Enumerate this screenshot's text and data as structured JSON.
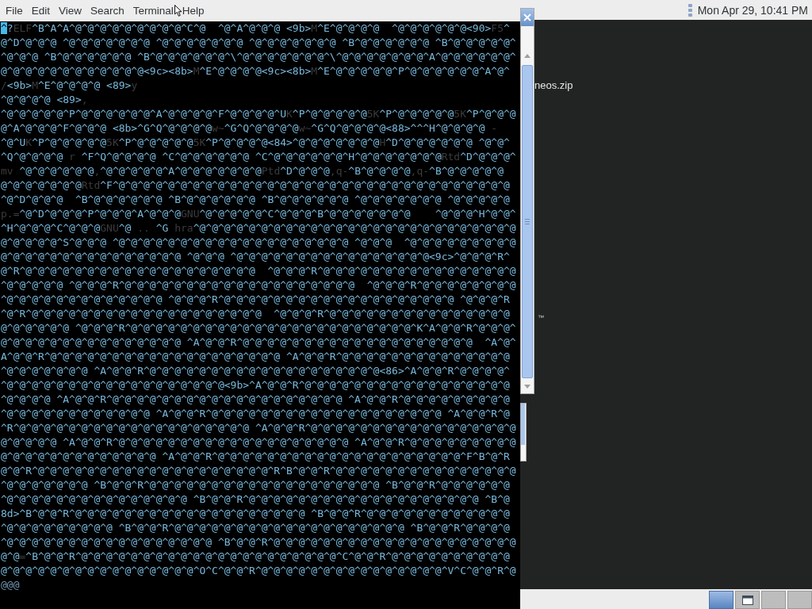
{
  "terminal": {
    "menu": [
      "File",
      "Edit",
      "View",
      "Search",
      "Terminal",
      "Help"
    ],
    "lines": [
      [
        {
          "kind": "cursor",
          "text": "^"
        },
        {
          "kind": "escape",
          "text": "?"
        },
        {
          "kind": "dim",
          "text": "ELF"
        },
        {
          "kind": "escape",
          "text": "^B^A^A^@^@^@^@^@^@^@^@^@^C^@  ^@^A^@^@^@ <9b>"
        },
        {
          "kind": "dim",
          "text": "M"
        },
        {
          "kind": "escape",
          "text": "^E^@^@^@^@  ^@^@^@^@^@^@<90>"
        },
        {
          "kind": "dim",
          "text": "F5"
        },
        {
          "kind": "escape",
          "text": "^"
        }
      ],
      [
        {
          "kind": "escape",
          "text": "@^D^@^@^@ ^@^@^@^@^@^@^@ ^@^@^@^@^@^@^@ ^@^@^@^@^@^@^@ ^B^@^@^@^@^@^@ ^B^@^@^@^@^@^"
        }
      ],
      [
        {
          "kind": "escape",
          "text": "^@^@^@ ^B^@^@^@^@^@^@ ^B^@^@^@^@^@^@^\\^@^@^@^@^@^@^@^\\^@^@^@^@^@^@^@^A^@^@^@^@^@^@^"
        }
      ],
      [
        {
          "kind": "escape",
          "text": "@^@^@^@^@^@^@^@^@^@^@^@<9c><8b>"
        },
        {
          "kind": "dim",
          "text": "M"
        },
        {
          "kind": "escape",
          "text": "^E^@^@^@^@<9c><8b>"
        },
        {
          "kind": "dim",
          "text": "M"
        },
        {
          "kind": "escape",
          "text": "^E^@^@^@^@^@^P^@^@^@^@^@^@^A^@^"
        }
      ],
      [
        {
          "kind": "dim",
          "text": "/"
        },
        {
          "kind": "escape",
          "text": "<9b>"
        },
        {
          "kind": "dim",
          "text": "M"
        },
        {
          "kind": "escape",
          "text": "^E^@^@^@^@ <89>"
        },
        {
          "kind": "dim",
          "text": "y"
        }
      ],
      [
        {
          "kind": "escape",
          "text": "^@^@^@^@ <89>"
        },
        {
          "kind": "dim",
          "text": ","
        }
      ],
      [
        {
          "kind": "escape",
          "text": "^@^@^@^@^@^P^@^@^@^@^@^@^A^@^@^@^@^F^@^@^@^@^U"
        },
        {
          "kind": "dim",
          "text": "K"
        },
        {
          "kind": "escape",
          "text": "^P^@^@^@^@^@"
        },
        {
          "kind": "dim",
          "text": "5K"
        },
        {
          "kind": "escape",
          "text": "^P^@^@^@^@^@"
        },
        {
          "kind": "dim",
          "text": "5K"
        },
        {
          "kind": "escape",
          "text": "^P^@^@^@"
        }
      ],
      [
        {
          "kind": "escape",
          "text": "@^A^@^@^@^F^@^@^@ <8b>^G^Q^@^@^@^@"
        },
        {
          "kind": "dim",
          "text": "w~"
        },
        {
          "kind": "escape",
          "text": "^G^Q^@^@^@^@"
        },
        {
          "kind": "dim",
          "text": "w~"
        },
        {
          "kind": "escape",
          "text": "^G^Q^@^@^@^@<88>^^^H^@^@^@^@"
        },
        {
          "kind": "dim",
          "text": " -"
        }
      ],
      [
        {
          "kind": "escape",
          "text": "^@^U"
        },
        {
          "kind": "dim",
          "text": "K"
        },
        {
          "kind": "escape",
          "text": "^P^@^@^@^@^@"
        },
        {
          "kind": "dim",
          "text": "5K"
        },
        {
          "kind": "escape",
          "text": "^P^@^@^@^@^@"
        },
        {
          "kind": "dim",
          "text": "5K"
        },
        {
          "kind": "escape",
          "text": "^P^@^@^@^@<84>^@^@^@^@^@^@^@"
        },
        {
          "kind": "dim",
          "text": "H"
        },
        {
          "kind": "escape",
          "text": "^D^@^@^@^@^@^@ ^@^@^"
        }
      ],
      [
        {
          "kind": "escape",
          "text": "^Q^@^@^@^@"
        },
        {
          "kind": "dim",
          "text": " r "
        },
        {
          "kind": "escape",
          "text": "^F^Q^@^@^@^@ ^C^@^@^@^@^@^@ ^C^@^@^@^@^@^@^H^@^@^@^@^@^@^@"
        },
        {
          "kind": "dim",
          "text": "Rtd"
        },
        {
          "kind": "escape",
          "text": "^D^@^@^@^"
        }
      ],
      [
        {
          "kind": "dim",
          "text": "mv "
        },
        {
          "kind": "escape",
          "text": "^@^@^@^@^@^@"
        },
        {
          "kind": "dim",
          "text": ","
        },
        {
          "kind": "escape",
          "text": "^@^@^@^@^@^A^@^@^@^@^@^@^@"
        },
        {
          "kind": "dim",
          "text": "Ptd"
        },
        {
          "kind": "escape",
          "text": "^D^@^@^@"
        },
        {
          "kind": "dim",
          "text": ",q-"
        },
        {
          "kind": "escape",
          "text": "^B^@^@^@^@"
        },
        {
          "kind": "dim",
          "text": ",q-"
        },
        {
          "kind": "escape",
          "text": "^B^@^@^@^@^@"
        }
      ],
      [
        {
          "kind": "escape",
          "text": "@^@^@^@^@^@^@"
        },
        {
          "kind": "dim",
          "text": "Rtd"
        },
        {
          "kind": "escape",
          "text": "^F^@^@^@^@^@^@^@^@^@^@^@^@^@^@^@^@^@^@^@^@^@^@^@^@^@^@^@^@^@^@^@^@"
        }
      ],
      [
        {
          "kind": "escape",
          "text": "^@^D^@^@^@  ^B^@^@^@^@^@^@ ^B^@^@^@^@^@^@ ^B^@^@^@^@^@^@ ^@^@^@^@^@^@^@ ^@^@^@^@^@"
        }
      ],
      [
        {
          "kind": "dim",
          "text": "p.="
        },
        {
          "kind": "escape",
          "text": "^@^D^@^@^@^P^@^@^@^A^@^@^@"
        },
        {
          "kind": "dim",
          "text": "GNU"
        },
        {
          "kind": "escape",
          "text": "^@^@^@^@^@^C^@^@^@^B^@^@^@^@^@^@^@    ^@^@^@^H^@^@^"
        }
      ],
      [
        {
          "kind": "escape",
          "text": "^H^@^@^@^C^@^@^@"
        },
        {
          "kind": "dim",
          "text": "GNU"
        },
        {
          "kind": "escape",
          "text": "^@"
        },
        {
          "kind": "dim",
          "text": " .. "
        },
        {
          "kind": "escape",
          "text": "^G"
        },
        {
          "kind": "dim",
          "text": " hra"
        },
        {
          "kind": "escape",
          "text": "^@^@^@^@^@^@^@^@^@^@^@^@^@^@^@^@^@^@^@^@^@^@^@^@^@^@"
        }
      ],
      [
        {
          "kind": "escape",
          "text": "@^@^@^@^@^S^@^@^@ ^@^@^@^@^@^@^@^@^@^@^@^@^@^@^@^@^@^@^@ ^@^@^@  ^@^@^@^@^@^@^@^@^@"
        }
      ],
      [
        {
          "kind": "escape",
          "text": "@^@^@^@^@^@^@^@^@^@^@^@^@^@^@ ^@^@^@ ^@^@^@^@^@^@^@^@^@^@^@^@^@^@^@^@<9c>^@^@^@^R^"
        }
      ],
      [
        {
          "kind": "escape",
          "text": "@^R^@^@^@^@^@^@^@^@^@^@^@^@^@^@^@^@^@^@^@  ^@^@^@^R^@^@^@^@^@^@^@^@^@^@^@^@^@^@^@^@"
        }
      ],
      [
        {
          "kind": "escape",
          "text": "^@^@^@^@^@ ^@^@^@^R^@^@^@^@^@^@^@^@^@^@^@^@^@^@^@^@^@^@^@  ^@^@^@^R^@^@^@^@^@^@^@^@"
        }
      ],
      [
        {
          "kind": "escape",
          "text": "^@^@^@^@^@^@^@^@^@^@^@^@^@ ^@^@^@^R^@^@^@^@^@^@^@^@^@^@^@^@^@^@^@^@^@^@^@ ^@^@^@^R"
        }
      ],
      [
        {
          "kind": "escape",
          "text": "^@^R^@^@^@^@^@^@^@^@^@^@^@^@^@^@^@^@^@^@^@  ^@^@^@^R^@^@^@^@^@^@^@^@^@^@^@^@^@^@^@"
        }
      ],
      [
        {
          "kind": "escape",
          "text": "@^@^@^@^@^@ ^@^@^@^R^@^@^@^@^@^@^@^@^@^@^@^@^@^@^@^@^@^@^@^@^@^@^@^K^A^@^@^R^@^@^@^"
        }
      ],
      [
        {
          "kind": "escape",
          "text": "@^@^@^@^@^@^@^@^@^@^@^@^@^@^@ ^A^@^@^R^@^@^@^@^@^@^@^@^@^@^@^@^@^@^@^@^@^@^@  ^A^@^"
        }
      ],
      [
        {
          "kind": "escape",
          "text": "A^@^@^R^@^@^@^@^@^@^@^@^@^@^@^@^@^@^@^@^@^@^@ ^A^@^@^R^@^@^@^@^@^@^@^@^@^@^@^@^@^@"
        }
      ],
      [
        {
          "kind": "escape",
          "text": "^@^@^@^@^@^@^@ ^A^@^@^R^@^@^@^@^@^@^@^@^@^@^@^@^@^@^@^@^@^@^@<86>^A^@^@^R^@^@^@^@^"
        }
      ],
      [
        {
          "kind": "escape",
          "text": "^@^@^@^@^@^@^@^@^@^@^@^@^@^@^@^@^@^@<9b>^A^@^@^R^@^@^@^@^@^@^@^@^@^@^@^@^@^@^@^@^@"
        }
      ],
      [
        {
          "kind": "escape",
          "text": "^@^@^@^@ ^A^@^@^R^@^@^@^@^@^@^@^@^@^@^@^@^@^@^@^@^@^@^@ ^A^@^@^R^@^@^@^@^@^@^@^@^@"
        }
      ],
      [
        {
          "kind": "escape",
          "text": "^@^@^@^@^@^@^@^@^@^@^@^@ ^A^@^@^R^@^@^@^@^@^@^@^@^@^@^@^@^@^@^@^@^@^@^@ ^A^@^@^R^@"
        }
      ],
      [
        {
          "kind": "escape",
          "text": "^R^@^@^@^@^@^@^@^@^@^@^@^@^@^@^@^@^@^@^@ ^A^@^@^R^@^@^@^@^@^@^@^@^@^@^@^@^@^@^@^@^@"
        }
      ],
      [
        {
          "kind": "escape",
          "text": "@^@^@^@^@ ^A^@^@^R^@^@^@^@^@^@^@^@^@^@^@^@^@^@^@^@^@^@^@ ^A^@^@^R^@^@^@^@^@^@^@^@^@"
        }
      ],
      [
        {
          "kind": "escape",
          "text": "@^@^@^@^@^@^@^@^@^@^@^@^@ ^A^@^@^R^@^@^@^@^@^@^@^@^@^@^@^@^@^@^@^@^@^@^@^@^F^B^@^R"
        }
      ],
      [
        {
          "kind": "escape",
          "text": "@^@^R^@^@^@^@^@^@^@^@^@^@^@^@^@^@^@^@^@^@^@^R^B^@^@^R^@^@^@^@^@^@^@^@^@^@^@^@^@^@^@"
        }
      ],
      [
        {
          "kind": "escape",
          "text": "^@^@^@^@^@^@^@ ^B^@^@^R^@^@^@^@^@^@^@^@^@^@^@^@^@^@^@^@^@^@^@ ^B^@^@^R^@^@^@^@^@^@"
        }
      ],
      [
        {
          "kind": "escape",
          "text": "^@^@^@^@^@^@^@^@^@^@^@^@^@^@^@ ^B^@^@^R^@^@^@^@^@^@^@^@^@^@^@^@^@^@^@^@^@^@^@ ^B^@"
        }
      ],
      [
        {
          "kind": "escape",
          "text": "8d>^B^@^@^R^@^@^@^@^@^@^@^@^@^@^@^@^@^@^@^@^@^@^@ ^B^@^@^R^@^@^@^@^@^@^@^@^@^@^@^@"
        }
      ],
      [
        {
          "kind": "escape",
          "text": "^@^@^@^@^@^@^@^@^@ ^B^@^@^R^@^@^@^@^@^@^@^@^@^@^@^@^@^@^@^@^@^@^@ ^B^@^@^R^@^@^@^@"
        }
      ],
      [
        {
          "kind": "escape",
          "text": "^@^@^@^@^@^@^@^@^@^@^@^@^@^@^@^@^@ ^B^@^@^R^@^@^@^@^@^@^@^@^@^@^@^@^@^@^@^@^@^@^@^@"
        }
      ],
      [
        {
          "kind": "escape",
          "text": "@^@"
        },
        {
          "kind": "dim",
          "text": "="
        },
        {
          "kind": "escape",
          "text": "^B^@^@^R^@^@^@^@^@^@^@^@^@^@^@^@^@^@^@^@^@^@^@^@^@^C^@^@^R^@^@^@^@^@^@^@^@^@^@"
        }
      ],
      [
        {
          "kind": "escape",
          "text": "@^@^@^@^@^@^@^@^@^@^@^@^@^@^@^@^O^C^@^@^R^@^@^@^@^@^@^@^@^@^@^@^@^@^@^@^V^C^@^@^R^@"
        }
      ],
      [
        {
          "kind": "filler",
          "text": "@@@"
        }
      ]
    ]
  },
  "top_panel": {
    "clock": "Mon Apr 29, 10:41 PM"
  },
  "desktop": {
    "icon_labels": [
      "neos.zip",
      "™"
    ]
  },
  "taskbar": {
    "buttons": [
      {
        "kind": "plain",
        "selected": true
      },
      {
        "kind": "window",
        "selected": false
      },
      {
        "kind": "plain",
        "selected": false
      },
      {
        "kind": "plain",
        "selected": false
      }
    ]
  }
}
